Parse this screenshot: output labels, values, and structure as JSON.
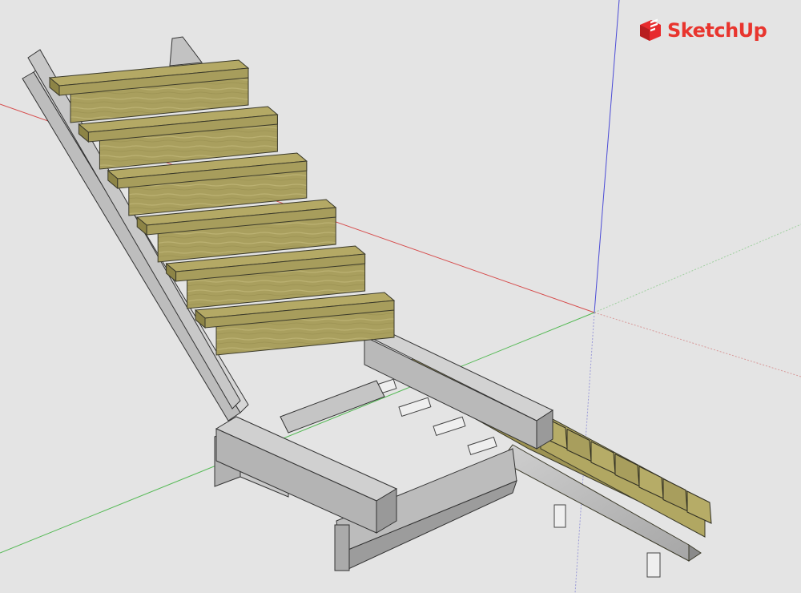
{
  "app": {
    "name": "SketchUp",
    "logo_icon": "sketchup-logo-icon",
    "brand_color": "#e72b2d"
  },
  "viewport": {
    "background": "#e4e4e4",
    "axis_colors": {
      "red": "#d64b4b",
      "green": "#54b954",
      "blue": "#4b4bd6"
    }
  },
  "model": {
    "materials": {
      "wood_tread": "#b4a965",
      "wood_riser": "#a79d5c",
      "wood_dark": "#8d8446",
      "steel_light": "#c4c4c4",
      "steel_mid": "#a9a9a9",
      "steel_dark": "#8a8a8a",
      "concrete": "#ececec"
    },
    "main_stair_tread_count": 6,
    "secondary_stair_step_count": 7
  }
}
